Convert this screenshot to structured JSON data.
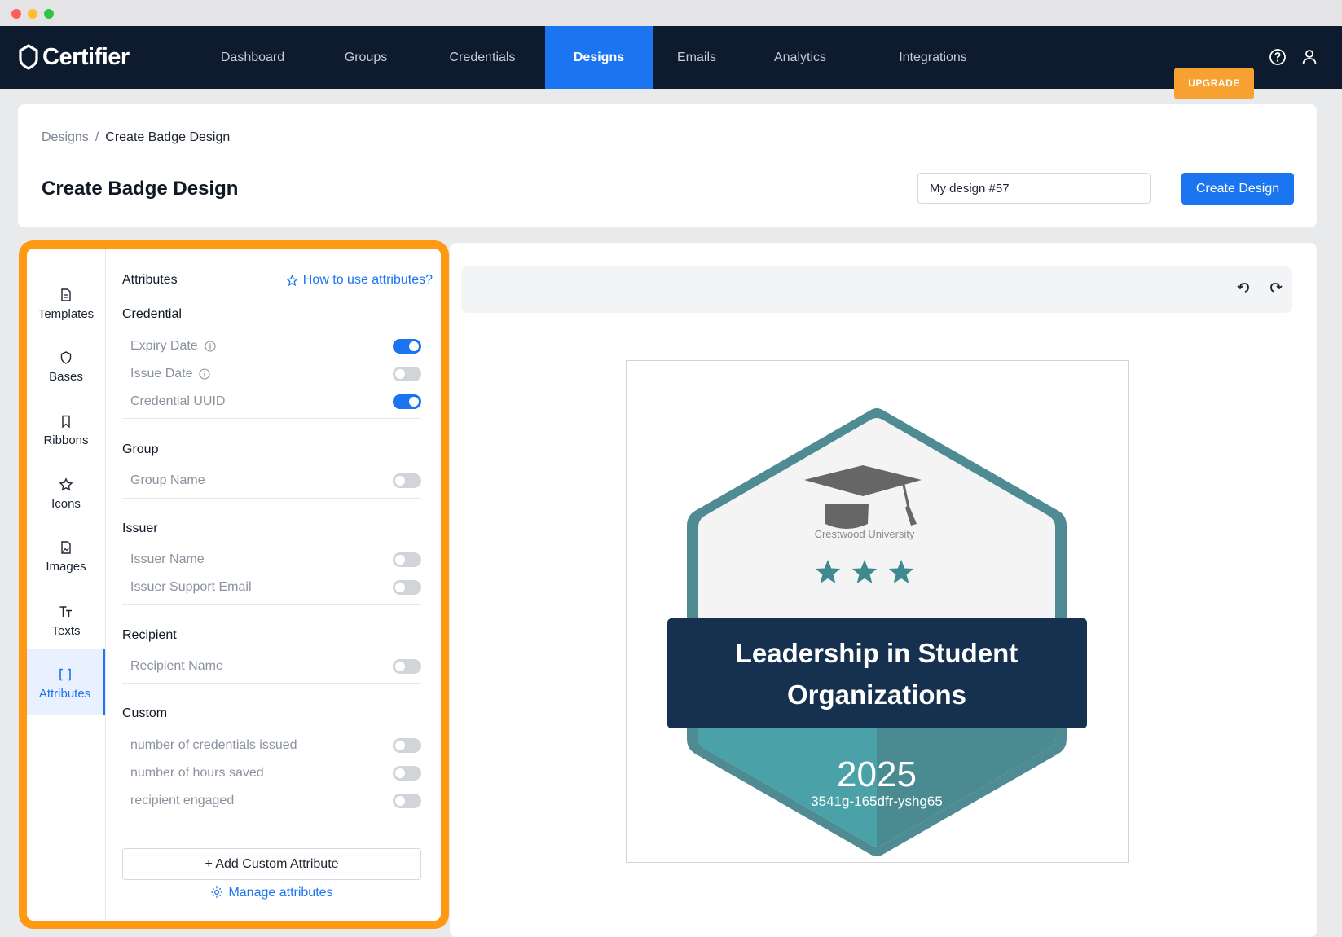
{
  "app": {
    "logo_text": "Certifier",
    "nav": [
      "Dashboard",
      "Groups",
      "Credentials",
      "Designs",
      "Emails",
      "Analytics",
      "Integrations"
    ],
    "active_nav": "Designs",
    "upgrade_label": "UPGRADE",
    "icons": [
      "help-icon",
      "user-icon"
    ]
  },
  "header": {
    "breadcrumb": [
      "Designs",
      "Create Badge Design"
    ],
    "breadcrumb_sep": "/",
    "title": "Create Badge Design",
    "design_name_value": "My design #57",
    "create_button": "Create Design"
  },
  "tools": [
    "Templates",
    "Bases",
    "Ribbons",
    "Icons",
    "Images",
    "Texts",
    "Attributes"
  ],
  "active_tool": "Attributes",
  "attributes": {
    "title": "Attributes",
    "help_link": "How to use attributes?",
    "sections": [
      {
        "name": "Credential",
        "items": [
          {
            "label": "Expiry Date",
            "info": true,
            "on": true
          },
          {
            "label": "Issue Date",
            "info": true,
            "on": false
          },
          {
            "label": "Credential UUID",
            "info": false,
            "on": true
          }
        ]
      },
      {
        "name": "Group",
        "items": [
          {
            "label": "Group Name",
            "info": false,
            "on": false
          }
        ]
      },
      {
        "name": "Issuer",
        "items": [
          {
            "label": "Issuer Name",
            "info": false,
            "on": false
          },
          {
            "label": "Issuer Support Email",
            "info": false,
            "on": false
          }
        ]
      },
      {
        "name": "Recipient",
        "items": [
          {
            "label": "Recipient Name",
            "info": false,
            "on": false
          }
        ]
      },
      {
        "name": "Custom",
        "items": [
          {
            "label": "number of credentials issued",
            "info": false,
            "on": false
          },
          {
            "label": "number of hours saved",
            "info": false,
            "on": false
          },
          {
            "label": "recipient engaged",
            "info": false,
            "on": false
          }
        ]
      }
    ],
    "add_button": "+  Add Custom Attribute",
    "manage_link": "Manage attributes"
  },
  "badge": {
    "institution": "Crestwood University",
    "title_line1": "Leadership in Student",
    "title_line2": "Organizations",
    "year": "2025",
    "uuid": "3541g-165dfr-yshg65",
    "colors": {
      "frame": "#4f8b93",
      "banner": "#16304f",
      "teal_left": "#4aa2a8",
      "teal_right": "#4a8b92",
      "star": "#3f8a90"
    }
  }
}
